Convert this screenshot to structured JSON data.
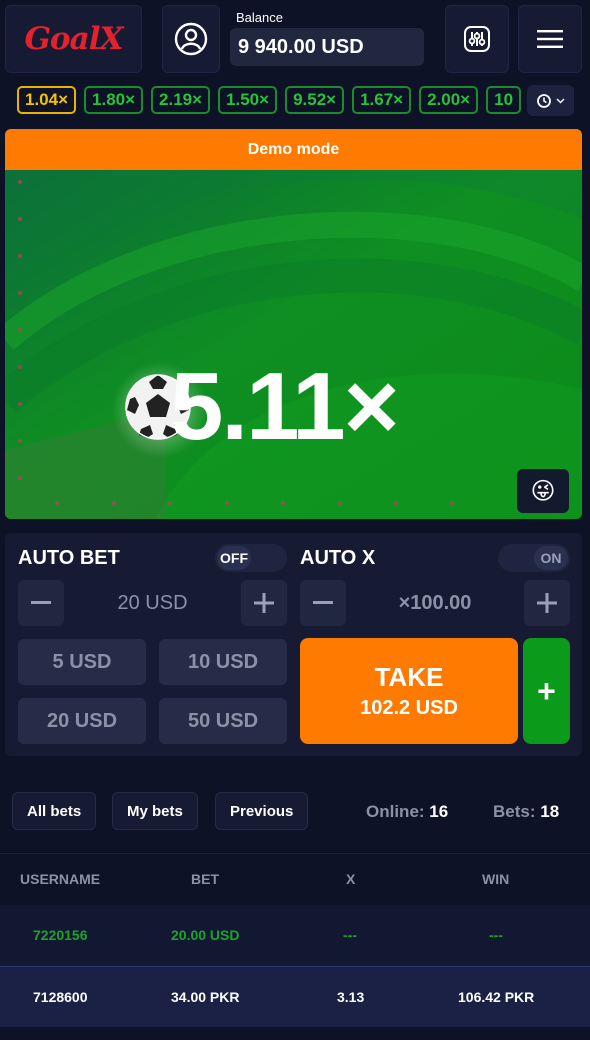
{
  "header": {
    "logo": "GoalX",
    "balance_label": "Balance",
    "balance_value": "9 940.00 USD"
  },
  "history": {
    "multipliers": [
      "1.04×",
      "1.80×",
      "2.19×",
      "1.50×",
      "9.52×",
      "1.67×",
      "2.00×",
      "10"
    ]
  },
  "game": {
    "demo_label": "Demo mode",
    "multiplier": "5.11×",
    "emoji": "😜"
  },
  "auto_bet": {
    "title": "AUTO BET",
    "toggle": "OFF",
    "amount": "20 USD",
    "quick": [
      "5 USD",
      "10 USD",
      "20 USD",
      "50 USD"
    ]
  },
  "auto_x": {
    "title": "AUTO X",
    "toggle": "ON",
    "value": "×100.00"
  },
  "take": {
    "label": "TAKE",
    "amount": "102.2 USD",
    "plus": "+"
  },
  "bets": {
    "tabs": [
      "All bets",
      "My bets",
      "Previous"
    ],
    "online_label": "Online:",
    "online_value": "16",
    "bets_label": "Bets:",
    "bets_value": "18",
    "columns": [
      "USERNAME",
      "BET",
      "X",
      "WIN"
    ],
    "rows": [
      {
        "username": "7220156",
        "bet": "20.00 USD",
        "x": "---",
        "win": "---"
      },
      {
        "username": "7128600",
        "bet": "34.00 PKR",
        "x": "3.13",
        "win": "106.42 PKR"
      }
    ]
  },
  "colors": {
    "accent_orange": "#ff7a00",
    "accent_green": "#0b9a1a",
    "bg": "#0e1226",
    "panel": "#161b33"
  }
}
